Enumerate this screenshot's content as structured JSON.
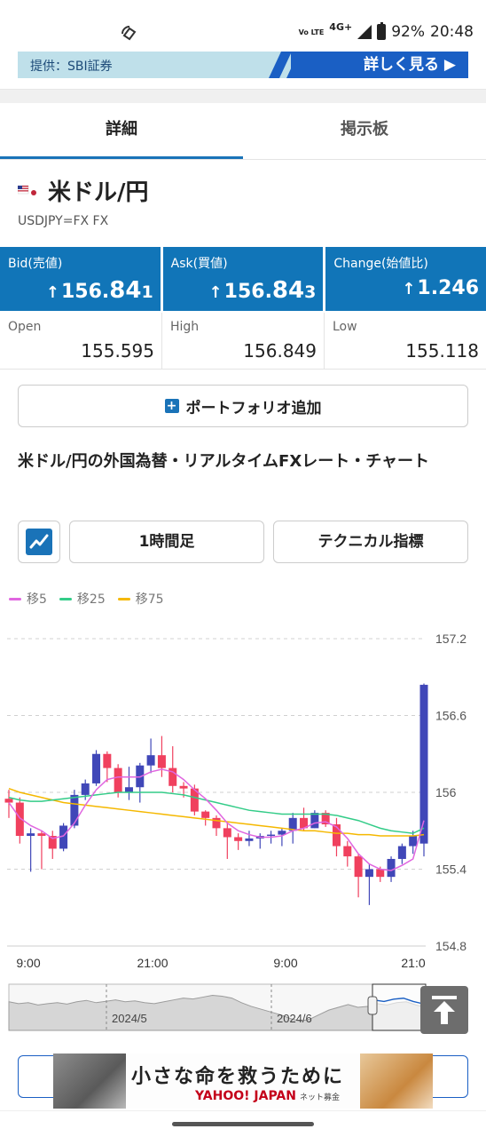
{
  "status_bar": {
    "network_volte": "Vo LTE",
    "network_type": "4G+",
    "battery": "92%",
    "time": "20:48"
  },
  "banner": {
    "provider": "提供：SBI証券",
    "button": "詳しく見る ▶"
  },
  "tabs": [
    {
      "label": "詳細",
      "active": true
    },
    {
      "label": "掲示板",
      "active": false
    }
  ],
  "instrument": {
    "name": "米ドル/円",
    "ticker": "USDJPY=FX FX"
  },
  "quotes": [
    {
      "label": "Bid(売値)",
      "arrow": "↑",
      "int": "156.",
      "big": "84",
      "small": "1"
    },
    {
      "label": "Ask(買値)",
      "arrow": "↑",
      "int": "156.",
      "big": "84",
      "small": "3"
    },
    {
      "label": "Change(始値比)",
      "arrow": "↑",
      "int": "1.246",
      "big": "",
      "small": ""
    }
  ],
  "ohl": [
    {
      "label": "Open",
      "value": "155.595"
    },
    {
      "label": "High",
      "value": "156.849"
    },
    {
      "label": "Low",
      "value": "155.118"
    }
  ],
  "portfolio_button": "ポートフォリオ追加",
  "section_heading": "米ドル/円の外国為替・リアルタイムFXレート・チャート",
  "controls": {
    "interval": "1時間足",
    "technical": "テクニカル指標"
  },
  "legend": [
    {
      "label": "移5",
      "color": "#e066e0"
    },
    {
      "label": "移25",
      "color": "#33cc88"
    },
    {
      "label": "移75",
      "color": "#f5b800"
    }
  ],
  "colors": {
    "up": "#4047b8",
    "down": "#f0405e",
    "accent": "#1175b8"
  },
  "chart_data": {
    "type": "candlestick",
    "y_ticks": [
      "157.2",
      "156.6",
      "156",
      "155.4",
      "154.8"
    ],
    "ylim": [
      154.8,
      157.2
    ],
    "x_ticks": [
      "9:00",
      "21:00",
      "9:00",
      "21:0"
    ],
    "candles": [
      {
        "o": 155.95,
        "c": 155.92,
        "h": 156.02,
        "l": 155.8
      },
      {
        "o": 155.92,
        "c": 155.66,
        "h": 155.96,
        "l": 155.6
      },
      {
        "o": 155.66,
        "c": 155.68,
        "h": 155.72,
        "l": 155.38
      },
      {
        "o": 155.68,
        "c": 155.66,
        "h": 155.7,
        "l": 155.4
      },
      {
        "o": 155.66,
        "c": 155.56,
        "h": 155.7,
        "l": 155.48
      },
      {
        "o": 155.56,
        "c": 155.74,
        "h": 155.76,
        "l": 155.54
      },
      {
        "o": 155.74,
        "c": 155.98,
        "h": 156.02,
        "l": 155.72
      },
      {
        "o": 155.98,
        "c": 156.07,
        "h": 156.1,
        "l": 155.94
      },
      {
        "o": 156.07,
        "c": 156.3,
        "h": 156.33,
        "l": 156.05
      },
      {
        "o": 156.3,
        "c": 156.19,
        "h": 156.32,
        "l": 156.08
      },
      {
        "o": 156.19,
        "c": 156.0,
        "h": 156.22,
        "l": 155.96
      },
      {
        "o": 156.0,
        "c": 156.04,
        "h": 156.2,
        "l": 155.94
      },
      {
        "o": 156.04,
        "c": 156.21,
        "h": 156.23,
        "l": 155.92
      },
      {
        "o": 156.21,
        "c": 156.29,
        "h": 156.42,
        "l": 156.15
      },
      {
        "o": 156.29,
        "c": 156.19,
        "h": 156.44,
        "l": 156.12
      },
      {
        "o": 156.19,
        "c": 156.05,
        "h": 156.36,
        "l": 156.0
      },
      {
        "o": 156.05,
        "c": 156.03,
        "h": 156.08,
        "l": 155.96
      },
      {
        "o": 156.03,
        "c": 155.85,
        "h": 156.06,
        "l": 155.82
      },
      {
        "o": 155.85,
        "c": 155.8,
        "h": 155.86,
        "l": 155.74
      },
      {
        "o": 155.8,
        "c": 155.72,
        "h": 155.82,
        "l": 155.66
      },
      {
        "o": 155.72,
        "c": 155.65,
        "h": 155.76,
        "l": 155.48
      },
      {
        "o": 155.65,
        "c": 155.62,
        "h": 155.68,
        "l": 155.55
      },
      {
        "o": 155.62,
        "c": 155.64,
        "h": 155.7,
        "l": 155.58
      },
      {
        "o": 155.64,
        "c": 155.66,
        "h": 155.68,
        "l": 155.56
      },
      {
        "o": 155.66,
        "c": 155.67,
        "h": 155.7,
        "l": 155.6
      },
      {
        "o": 155.67,
        "c": 155.7,
        "h": 155.72,
        "l": 155.58
      },
      {
        "o": 155.7,
        "c": 155.8,
        "h": 155.84,
        "l": 155.6
      },
      {
        "o": 155.8,
        "c": 155.72,
        "h": 155.88,
        "l": 155.7
      },
      {
        "o": 155.72,
        "c": 155.84,
        "h": 155.86,
        "l": 155.72
      },
      {
        "o": 155.84,
        "c": 155.75,
        "h": 155.86,
        "l": 155.73
      },
      {
        "o": 155.75,
        "c": 155.58,
        "h": 155.8,
        "l": 155.5
      },
      {
        "o": 155.58,
        "c": 155.5,
        "h": 155.62,
        "l": 155.42
      },
      {
        "o": 155.5,
        "c": 155.34,
        "h": 155.52,
        "l": 155.18
      },
      {
        "o": 155.34,
        "c": 155.4,
        "h": 155.44,
        "l": 155.12
      },
      {
        "o": 155.4,
        "c": 155.34,
        "h": 155.42,
        "l": 155.3
      },
      {
        "o": 155.34,
        "c": 155.48,
        "h": 155.5,
        "l": 155.3
      },
      {
        "o": 155.48,
        "c": 155.58,
        "h": 155.6,
        "l": 155.44
      },
      {
        "o": 155.58,
        "c": 155.66,
        "h": 155.7,
        "l": 155.52
      },
      {
        "o": 155.6,
        "c": 156.84,
        "h": 156.85,
        "l": 155.5
      }
    ],
    "ma5": [
      155.92,
      155.8,
      155.74,
      155.7,
      155.64,
      155.66,
      155.76,
      155.9,
      156.02,
      156.1,
      156.12,
      156.12,
      156.12,
      156.16,
      156.18,
      156.16,
      156.1,
      156.02,
      155.95,
      155.86,
      155.76,
      155.7,
      155.67,
      155.65,
      155.65,
      155.66,
      155.7,
      155.72,
      155.76,
      155.77,
      155.73,
      155.64,
      155.52,
      155.44,
      155.4,
      155.39,
      155.43,
      155.48,
      155.78
    ],
    "ma25": [
      155.96,
      155.94,
      155.93,
      155.93,
      155.94,
      155.95,
      155.96,
      155.97,
      155.98,
      155.99,
      156.0,
      156.0,
      156.0,
      156.0,
      156.0,
      155.99,
      155.98,
      155.96,
      155.94,
      155.92,
      155.9,
      155.88,
      155.86,
      155.85,
      155.84,
      155.83,
      155.83,
      155.83,
      155.83,
      155.83,
      155.82,
      155.8,
      155.78,
      155.75,
      155.72,
      155.7,
      155.69,
      155.68,
      155.72
    ],
    "ma75": [
      156.03,
      156.0,
      155.98,
      155.96,
      155.94,
      155.92,
      155.91,
      155.9,
      155.89,
      155.88,
      155.87,
      155.86,
      155.85,
      155.84,
      155.83,
      155.82,
      155.81,
      155.8,
      155.79,
      155.78,
      155.77,
      155.76,
      155.75,
      155.74,
      155.73,
      155.72,
      155.71,
      155.7,
      155.7,
      155.69,
      155.68,
      155.68,
      155.67,
      155.67,
      155.66,
      155.66,
      155.66,
      155.66,
      155.67
    ],
    "navigator": {
      "labels": [
        "2024/5",
        "2024/6"
      ],
      "values": [
        0.62,
        0.58,
        0.6,
        0.55,
        0.58,
        0.6,
        0.57,
        0.62,
        0.65,
        0.6,
        0.63,
        0.66,
        0.62,
        0.64,
        0.6,
        0.58,
        0.62,
        0.66,
        0.7,
        0.68,
        0.72,
        0.76,
        0.74,
        0.7,
        0.6,
        0.52,
        0.46,
        0.4,
        0.34,
        0.26,
        0.2,
        0.24,
        0.34,
        0.44,
        0.5,
        0.56,
        0.5,
        0.52,
        0.58,
        0.55,
        0.6,
        0.62,
        0.55,
        0.5
      ]
    }
  },
  "ad": {
    "headline": "小さな命を救うために",
    "brand": "YAHOO! JAPAN",
    "brand_sub": "ネット募金"
  }
}
